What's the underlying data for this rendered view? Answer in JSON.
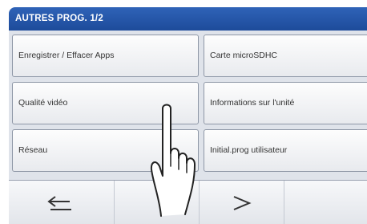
{
  "header": {
    "title": "AUTRES PROG. 1/2"
  },
  "menu": {
    "items": [
      {
        "label": "Enregistrer / Effacer Apps"
      },
      {
        "label": "Carte microSDHC"
      },
      {
        "label": "Qualité vidéo"
      },
      {
        "label": "Informations sur l'unité"
      },
      {
        "label": "Réseau"
      },
      {
        "label": "Initial.prog utilisateur"
      }
    ]
  },
  "navbar": {
    "buttons": [
      {
        "icon": "back-arrow-icon"
      },
      {
        "icon": "empty"
      },
      {
        "icon": "next-arrow-icon"
      },
      {
        "icon": "empty"
      }
    ]
  },
  "overlay": {
    "icon": "pointing-hand-icon"
  },
  "colors": {
    "header": "#2456a8",
    "background": "#dfe3ea",
    "button_border": "#8e97a6"
  }
}
